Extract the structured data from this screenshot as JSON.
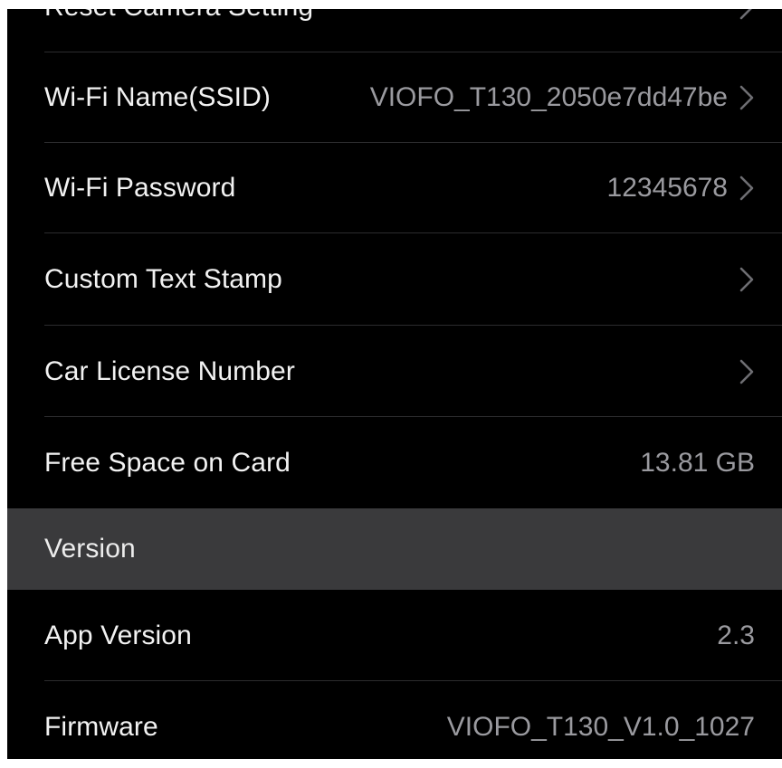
{
  "settings": {
    "reset": {
      "label": "Reset Camera Setting"
    },
    "wifi_name": {
      "label": "Wi-Fi Name(SSID)",
      "value": "VIOFO_T130_2050e7dd47be"
    },
    "wifi_password": {
      "label": "Wi-Fi Password",
      "value": "12345678"
    },
    "custom_text_stamp": {
      "label": "Custom Text Stamp"
    },
    "car_license": {
      "label": "Car License Number"
    },
    "free_space": {
      "label": "Free Space on Card",
      "value": "13.81 GB"
    }
  },
  "version_section": {
    "header": "Version",
    "app_version": {
      "label": "App Version",
      "value": "2.3"
    },
    "firmware": {
      "label": "Firmware",
      "value": "VIOFO_T130_V1.0_1027"
    }
  },
  "icons": {
    "chevron": "chevron-right-icon"
  },
  "colors": {
    "background": "#000000",
    "section_header_bg": "#3a3a3c",
    "value_text": "#9a9a9f",
    "label_text": "#f2f2f2"
  }
}
